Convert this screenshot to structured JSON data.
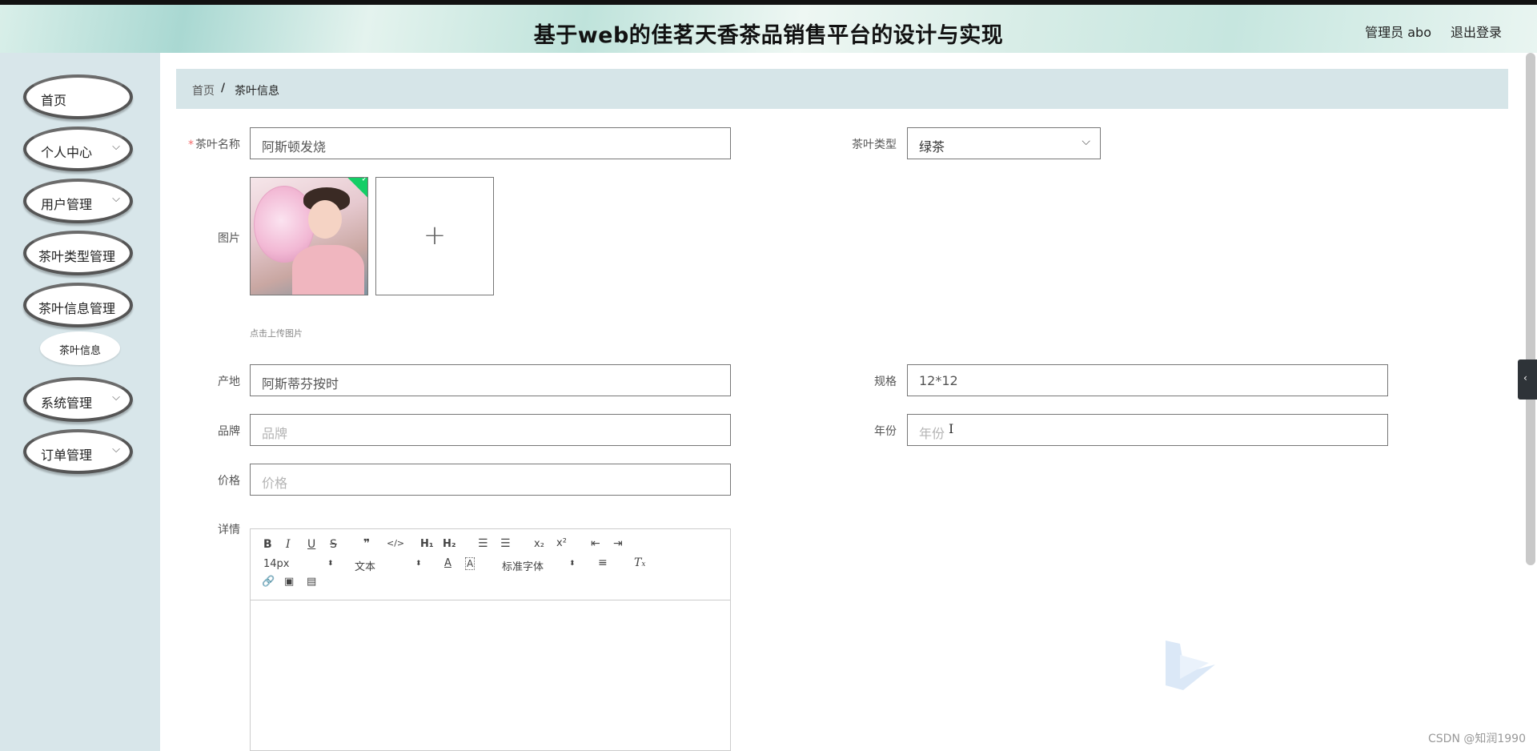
{
  "header": {
    "title": "基于web的佳茗天香茶品销售平台的设计与实现",
    "user": "管理员 abo",
    "logout": "退出登录"
  },
  "sidebar": {
    "items": [
      {
        "label": "首页"
      },
      {
        "label": "个人中心"
      },
      {
        "label": "用户管理"
      },
      {
        "label": "茶叶类型管理"
      },
      {
        "label": "茶叶信息管理"
      },
      {
        "label": "系统管理"
      },
      {
        "label": "订单管理"
      }
    ],
    "sub_item": "茶叶信息"
  },
  "breadcrumb": {
    "home": "首页",
    "separator": "/",
    "current": "茶叶信息"
  },
  "form": {
    "name_label": "茶叶名称",
    "name_value": "阿斯顿发烧",
    "type_label": "茶叶类型",
    "type_value": "绿茶",
    "image_label": "图片",
    "upload_hint": "点击上传图片",
    "origin_label": "产地",
    "origin_value": "阿斯蒂芬按时",
    "spec_label": "规格",
    "spec_value": "12*12",
    "brand_label": "品牌",
    "brand_placeholder": "品牌",
    "year_label": "年份",
    "year_placeholder": "年份",
    "price_label": "价格",
    "price_placeholder": "价格",
    "detail_label": "详情"
  },
  "editor": {
    "font_size": "14px",
    "text_style": "文本",
    "font_family": "标准字体"
  },
  "watermark": "CSDN @知润1990",
  "icons": [
    "chevron-down-icon",
    "plus-icon",
    "check-icon",
    "bold-icon",
    "italic-icon",
    "underline-icon",
    "strike-icon",
    "quote-icon",
    "code-icon",
    "ordered-list-icon",
    "bullet-list-icon",
    "subscript-icon",
    "superscript-icon",
    "outdent-icon",
    "indent-icon",
    "font-color-icon",
    "background-color-icon",
    "align-icon",
    "clear-format-icon",
    "link-icon",
    "image-icon",
    "video-icon",
    "collapse-left-icon"
  ]
}
